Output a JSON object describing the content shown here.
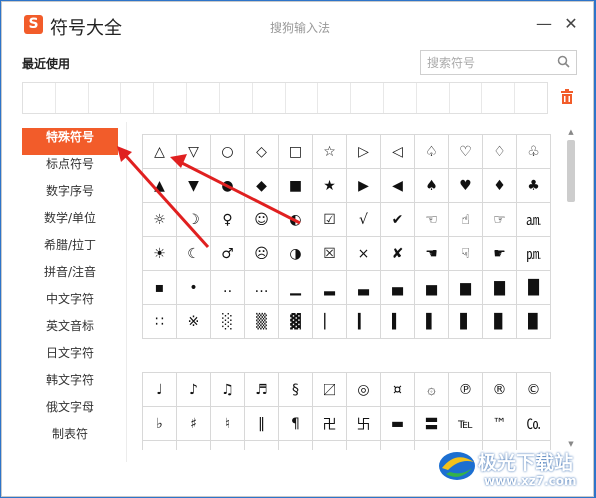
{
  "window": {
    "logo": "S",
    "title": "符号大全",
    "subtitle": "搜狗输入法",
    "minimize": "—",
    "close": "✕"
  },
  "recent": {
    "label": "最近使用",
    "cells": 16
  },
  "search": {
    "placeholder": "搜索符号",
    "value": ""
  },
  "colors": {
    "accent": "#f25c2a",
    "arrow": "#e02020",
    "desktop": "#2d74c9"
  },
  "categories": [
    {
      "label": "特殊符号",
      "active": true
    },
    {
      "label": "标点符号",
      "active": false
    },
    {
      "label": "数字序号",
      "active": false
    },
    {
      "label": "数学/单位",
      "active": false
    },
    {
      "label": "希腊/拉丁",
      "active": false
    },
    {
      "label": "拼音/注音",
      "active": false
    },
    {
      "label": "中文字符",
      "active": false
    },
    {
      "label": "英文音标",
      "active": false
    },
    {
      "label": "日文字符",
      "active": false
    },
    {
      "label": "韩文字符",
      "active": false
    },
    {
      "label": "俄文字母",
      "active": false
    },
    {
      "label": "制表符",
      "active": false
    }
  ],
  "symbols1": [
    [
      "△",
      "▽",
      "○",
      "◇",
      "□",
      "☆",
      "▷",
      "◁",
      "♤",
      "♡",
      "♢",
      "♧"
    ],
    [
      "▲",
      "▼",
      "●",
      "◆",
      "■",
      "★",
      "▶",
      "◀",
      "♠",
      "♥",
      "♦",
      "♣"
    ],
    [
      "☼",
      "☽",
      "♀",
      "☺",
      "◐",
      "☑",
      "√",
      "✔",
      "☜",
      "☝",
      "☞",
      "㏂"
    ],
    [
      "☀",
      "☾",
      "♂",
      "☹",
      "◑",
      "☒",
      "×",
      "✘",
      "☚",
      "☟",
      "☛",
      "㏘"
    ],
    [
      "▪",
      "•",
      "‥",
      "…",
      "▁",
      "▂",
      "▃",
      "▄",
      "▅",
      "▆",
      "▇",
      "█"
    ],
    [
      "∷",
      "※",
      "░",
      "▒",
      "▓",
      "▏",
      "▎",
      "▍",
      "▌",
      "▋",
      "▊",
      "▉"
    ]
  ],
  "symbols2": [
    [
      "♩",
      "♪",
      "♫",
      "♬",
      "§",
      "〼",
      "◎",
      "¤",
      "۞",
      "℗",
      "®",
      "©"
    ],
    [
      "♭",
      "♯",
      "♮",
      "‖",
      "¶",
      "卍",
      "卐",
      "▬",
      "〓",
      "℡",
      "™",
      "㏇"
    ],
    [
      "☰",
      "☱",
      "☲",
      "☳",
      "☴",
      "☵",
      "☶",
      "☷",
      "☯",
      "⚊",
      "⚋",
      "♨"
    ]
  ],
  "watermark": {
    "text": "极光下载站",
    "url": "www.xz7.com"
  }
}
